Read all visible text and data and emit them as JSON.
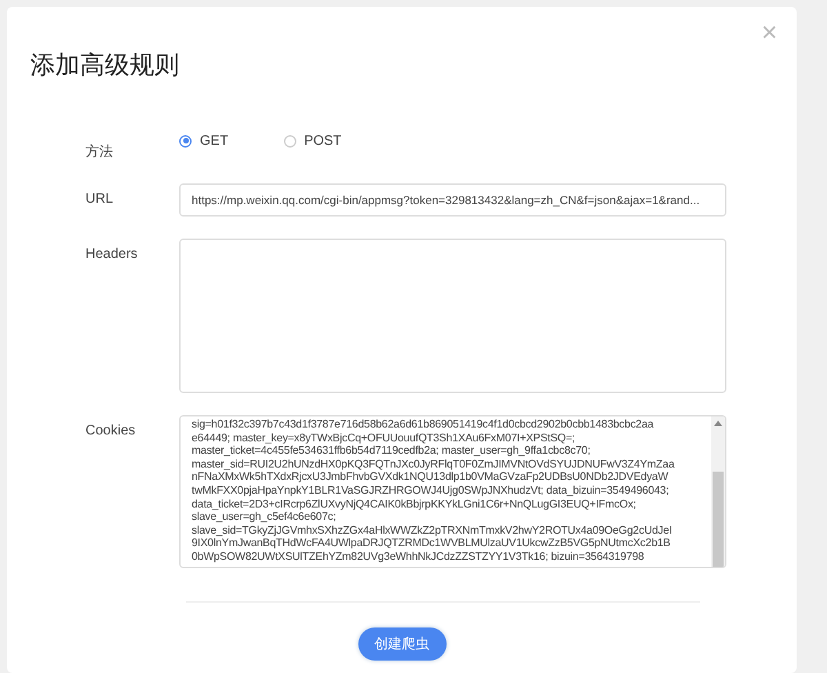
{
  "dialog": {
    "title": "添加高级规则",
    "close": "×"
  },
  "method": {
    "label": "方法",
    "options": [
      {
        "label": "GET",
        "selected": true
      },
      {
        "label": "POST",
        "selected": false
      }
    ]
  },
  "url": {
    "label": "URL",
    "value": "https://mp.weixin.qq.com/cgi-bin/appmsg?token=329813432&lang=zh_CN&f=json&ajax=1&rand..."
  },
  "headers": {
    "label": "Headers"
  },
  "cookies": {
    "label": "Cookies",
    "lines": [
      "sig=h01f32c397b7c43d1f3787e716d58b62a6d61b869051419c4f1d0cbcd2902b0cbb1483bcbc2aa",
      "e64449; master_key=x8yTWxBjcCq+OFUUouufQT3Sh1XAu6FxM07I+XPStSQ=;",
      "master_ticket=4c455fe534631ffb6b54d7119cedfb2a; master_user=gh_9ffa1cbc8c70;",
      "master_sid=RUI2U2hUNzdHX0pKQ3FQTnJXc0JyRFlqT0F0ZmJIMVNtOVdSYUJDNUFwV3Z4YmZaa",
      "nFNaXMxWk5hTXdxRjcxU3JmbFhvbGVXdk1NQU13dlp1b0VMaGVzaFp2UDBsU0NDb2JDVEdyaW",
      "twMkFXX0pjaHpaYnpkY1BLR1VaSGJRZHRGOWJ4Ujg0SWpJNXhudzVt; data_bizuin=3549496043;",
      "data_ticket=2D3+cIRcrp6ZlUXvyNjQ4CAIK0kBbjrpKKYkLGni1C6r+NnQLugGI3EUQ+IFmcOx;",
      "slave_user=gh_c5ef4c6e607c;",
      "slave_sid=TGkyZjJGVmhxSXhzZGx4aHlxWWZkZ2pTRXNmTmxkV2hwY2ROTUx4a09OeGg2cUdJeI",
      "9IX0lnYmJwanBqTHdWcFA4UWlpaDRJQTZRMDc1WVBLMUlzaUV1UkcwZzB5VG5pNUtmcXc2b1B",
      "0bWpSOW82UWtXSUlTZEhYZm82UVg3eWhhNkJCdzZZSTZYY1V3Tk16; bizuin=3564319798"
    ]
  },
  "submit": {
    "label": "创建爬虫"
  }
}
